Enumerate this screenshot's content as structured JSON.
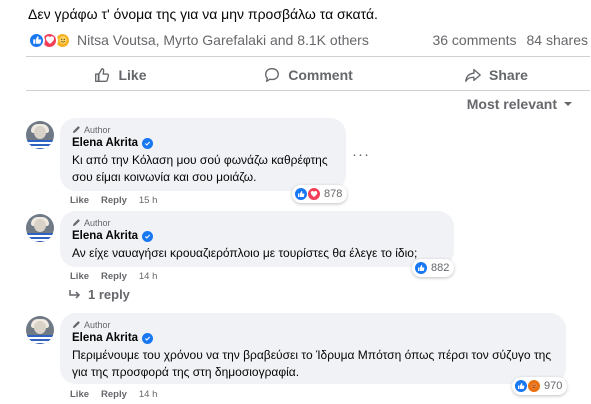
{
  "post": {
    "text": "Δεν γράφω τ' όνομα της για να μην προσβάλω τα σκατά.",
    "reactions_text": "Nitsa Voutsa, Myrto Garefalaki and 8.1K others",
    "comments_count": "36 comments",
    "shares_count": "84 shares"
  },
  "actions": {
    "like": "Like",
    "comment": "Comment",
    "share": "Share"
  },
  "sort": {
    "label": "Most relevant"
  },
  "comments": [
    {
      "badge": "Author",
      "name": "Elena Akrita",
      "text": "Κι από την Κόλαση μου σού φωνάζω καθρέφτης σου είμαι κοινωνία και σου μοιάζω.",
      "reaction_count": "878",
      "like_label": "Like",
      "reply_label": "Reply",
      "time": "15 h",
      "more": "···"
    },
    {
      "badge": "Author",
      "name": "Elena Akrita",
      "text": "Αν είχε ναυαγήσει κρουαζιερόπλοιο με τουρίστες θα έλεγε το ίδιο;",
      "reaction_count": "882",
      "like_label": "Like",
      "reply_label": "Reply",
      "time": "14 h",
      "replies_label": "1 reply"
    },
    {
      "badge": "Author",
      "name": "Elena Akrita",
      "text": "Περιμένουμε του χρόνου να την βραβεύσει το Ίδρυμα Μπότση όπως πέρσι τον σύζυγο της για της προσφορά της στη δημοσιογραφία.",
      "reaction_count": "970",
      "like_label": "Like",
      "reply_label": "Reply",
      "time": "14 h"
    }
  ],
  "colors": {
    "like_blue": "#1877f2",
    "love_red": "#f33e58",
    "angry_orange": "#e9710f",
    "bubble_bg": "#f0f2f5",
    "secondary_text": "#65676b"
  }
}
